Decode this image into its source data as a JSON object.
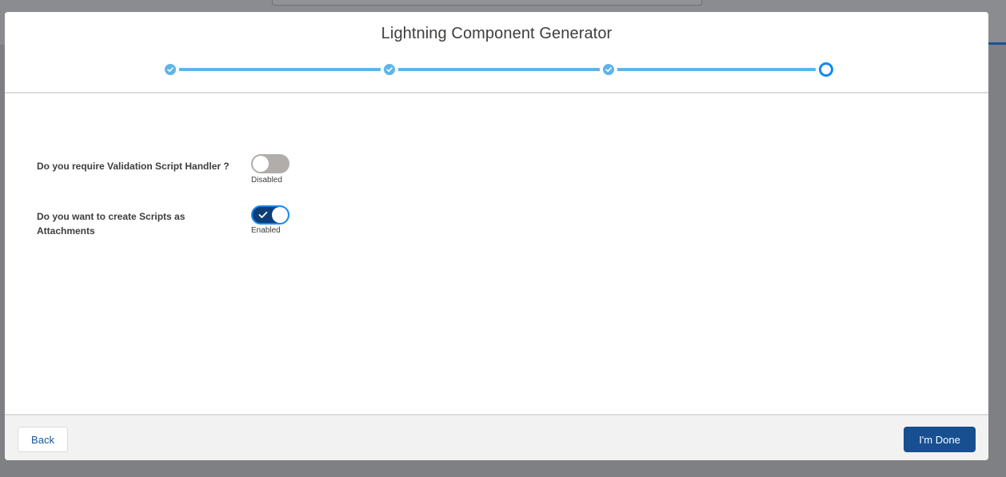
{
  "modal": {
    "title": "Lightning Component Generator"
  },
  "progress": {
    "steps": [
      {
        "status": "complete",
        "icon": "check-icon"
      },
      {
        "status": "complete",
        "icon": "check-icon"
      },
      {
        "status": "complete",
        "icon": "check-icon"
      },
      {
        "status": "current",
        "icon": "current-step-icon"
      }
    ],
    "accent_color": "#5fb4ea",
    "current_color": "#1589ee"
  },
  "settings": [
    {
      "label": "Do you require Validation Script Handler ?",
      "enabled": false,
      "status_text": "Disabled"
    },
    {
      "label": "Do you want to create Scripts as Attachments",
      "enabled": true,
      "status_text": "Enabled"
    }
  ],
  "footer": {
    "back_label": "Back",
    "done_label": "I'm Done"
  },
  "colors": {
    "brand": "#174f91",
    "toggle_on": "#0b3f7a",
    "toggle_off": "#b0adab"
  }
}
